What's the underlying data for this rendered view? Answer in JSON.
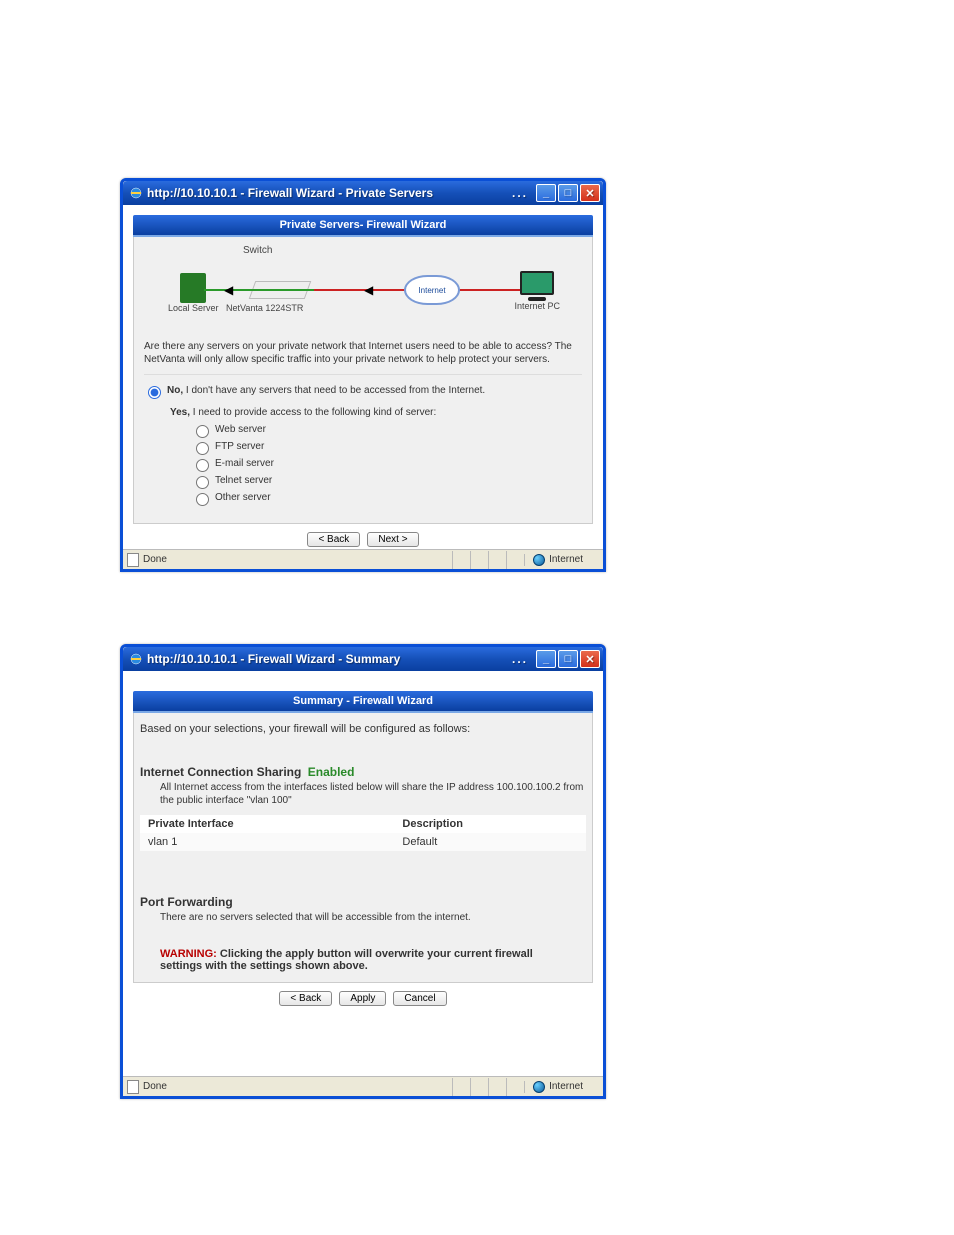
{
  "window1": {
    "title": "http://10.10.10.1 - Firewall Wizard - Private Servers",
    "panel_title": "Private Servers- Firewall Wizard",
    "diagram": {
      "switch_top": "Switch",
      "local_server": "Local Server",
      "netvanta": "NetVanta 1224STR",
      "internet": "Internet",
      "internet_pc": "Internet PC"
    },
    "question": "Are there any servers on your private network that Internet users need to be able to access? The NetVanta will only allow specific traffic into your private network to help protect your servers.",
    "no_bold": "No,",
    "no_rest": " I don't have any servers that need to be accessed from the Internet.",
    "yes_bold": "Yes,",
    "yes_rest": " I need to provide access to the following kind of server:",
    "options": {
      "web": "Web server",
      "ftp": "FTP server",
      "email": "E-mail server",
      "telnet": "Telnet server",
      "other": "Other server"
    },
    "btn_back": "< Back",
    "btn_next": "Next >",
    "status_done": "Done",
    "status_zone": "Internet"
  },
  "window2": {
    "title": "http://10.10.10.1 - Firewall Wizard - Summary",
    "panel_title": "Summary - Firewall Wizard",
    "intro": "Based on your selections, your firewall will be configured as follows:",
    "ics_title": "Internet Connection Sharing",
    "ics_status": "Enabled",
    "ics_desc": "All Internet access from the interfaces listed below will share the IP address 100.100.100.2 from the public interface \"vlan 100\"",
    "tbl_h1": "Private Interface",
    "tbl_h2": "Description",
    "tbl_c1": "vlan 1",
    "tbl_c2": "Default",
    "pf_title": "Port Forwarding",
    "pf_desc": "There are no servers selected that will be accessible from the internet.",
    "warn_label": "WARNING:",
    "warn_text": " Clicking the apply button will overwrite your current firewall settings with the settings shown above.",
    "btn_back": "< Back",
    "btn_apply": "Apply",
    "btn_cancel": "Cancel",
    "status_done": "Done",
    "status_zone": "Internet"
  }
}
